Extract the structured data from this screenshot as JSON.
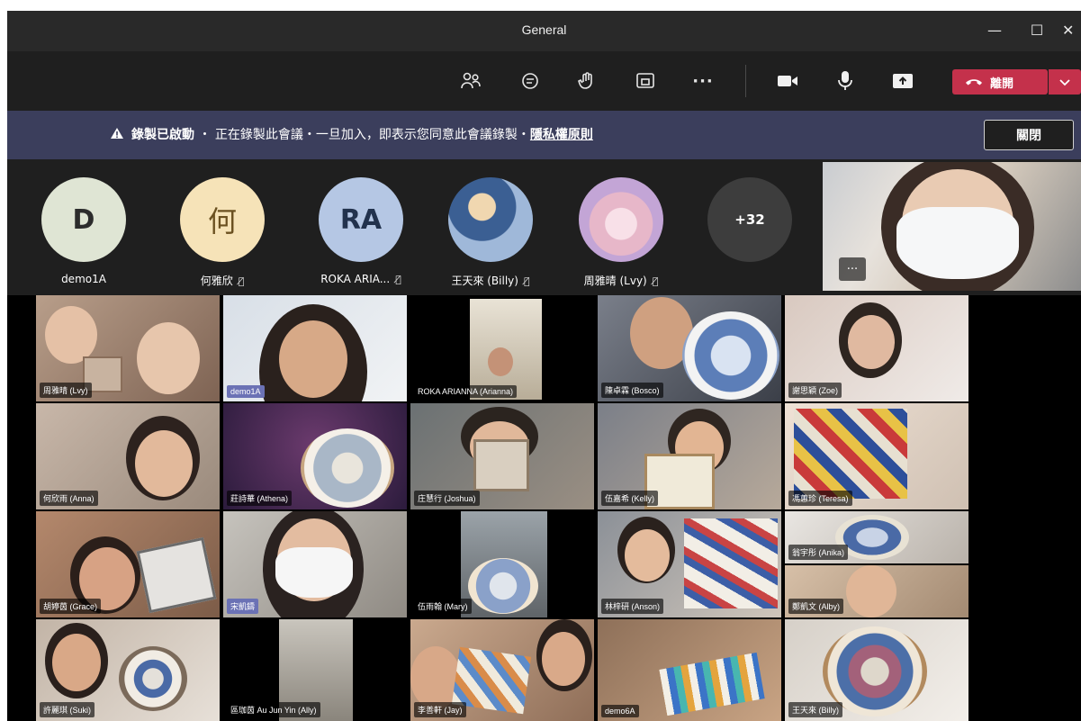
{
  "window": {
    "title": "General",
    "controls": [
      "minimize-icon",
      "maximize-icon",
      "close-icon"
    ]
  },
  "toolbar": {
    "icons": [
      "participants-icon",
      "chat-icon",
      "raise-hand-icon",
      "share-tray-icon",
      "more-icon",
      "camera-icon",
      "microphone-icon",
      "share-screen-icon"
    ],
    "leave_label": "離開",
    "leave_icon": "phone-hangup-icon",
    "leave_color": "#c4314b"
  },
  "banner": {
    "strong_text": "錄製已啟動",
    "text": "正在錄製此會議・一旦加入，即表示您同意此會議錄製・",
    "link": "隱私權原則",
    "dismiss_label": "關閉",
    "background": "#3b3e5c"
  },
  "participants_row": [
    {
      "initials": "D",
      "name": "demo1A",
      "muted": false,
      "color": "#dfe5d4"
    },
    {
      "initials": "何",
      "name": "何雅欣",
      "muted": true,
      "color": "#f6e3b8"
    },
    {
      "initials": "RA",
      "name": "ROKA ARIA...",
      "muted": true,
      "color": "#b5c7e4"
    },
    {
      "initials": "",
      "name": "王天來 (Billy)",
      "muted": true,
      "color": "#9fb8d9"
    },
    {
      "initials": "",
      "name": "周雅晴 (Lvy)",
      "muted": true,
      "color": "#e7b7c9"
    },
    {
      "initials": "+32",
      "name": "",
      "muted": false,
      "color": "#3d3d3d"
    }
  ],
  "self_view": {
    "more_label": "..."
  },
  "video_grid": [
    {
      "label": "周雅晴 (Lvy)"
    },
    {
      "label": "demo1A"
    },
    {
      "label": "ROKA ARIANNA (Arianna)"
    },
    {
      "label": "陳卓霖 (Bosco)"
    },
    {
      "label": "謝思穎 (Zoe)"
    },
    {
      "label": "何欣雨 (Anna)"
    },
    {
      "label": "莊詩華 (Athena)"
    },
    {
      "label": "庄慧行 (Joshua)"
    },
    {
      "label": "伍嘉希 (Kelly)"
    },
    {
      "label": "馮蕙珍 (Teresa)"
    },
    {
      "label": "翁宇彤 (Anika)"
    },
    {
      "label": "胡婷茵 (Grace)"
    },
    {
      "label": "宋凱鑄"
    },
    {
      "label": "伍雨翰 (Mary)"
    },
    {
      "label": "林梓研 (Anson)"
    },
    {
      "label": "鄭凱文 (Alby)"
    },
    {
      "label": "許麗琪 (Suki)"
    },
    {
      "label": "區珈茵 Au Jun Yin (Ally)"
    },
    {
      "label": "李善軒 (Jay)"
    },
    {
      "label": "demo6A"
    },
    {
      "label": "王天來 (Billy)"
    }
  ]
}
